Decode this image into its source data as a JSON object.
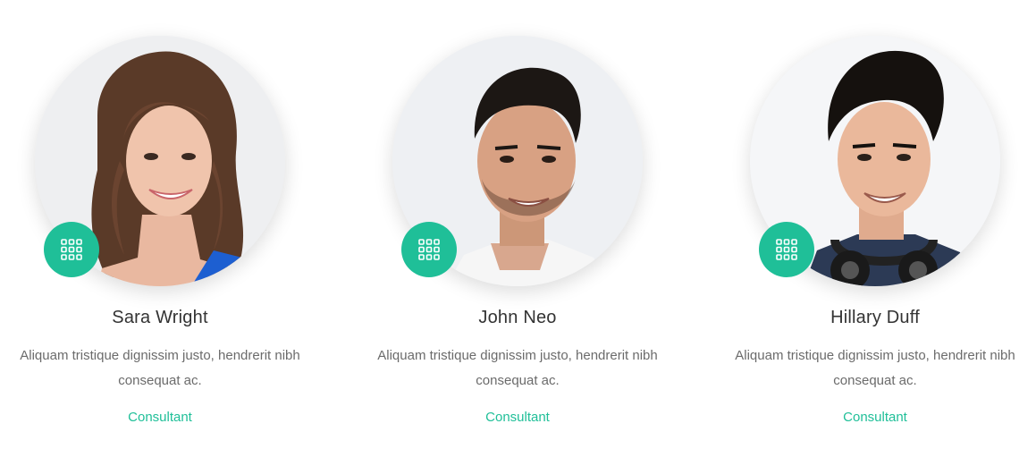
{
  "team": {
    "accent_color": "#1fbf98",
    "members": [
      {
        "name": "Sara Wright",
        "description": "Aliquam tristique dignissim justo, hendrerit nibh consequat ac.",
        "role": "Consultant",
        "badge_icon": "grid-icon"
      },
      {
        "name": "John Neo",
        "description": "Aliquam tristique dignissim justo, hendrerit nibh consequat ac.",
        "role": "Consultant",
        "badge_icon": "grid-icon"
      },
      {
        "name": "Hillary Duff",
        "description": "Aliquam tristique dignissim justo, hendrerit nibh consequat ac.",
        "role": "Consultant",
        "badge_icon": "grid-icon"
      }
    ]
  }
}
